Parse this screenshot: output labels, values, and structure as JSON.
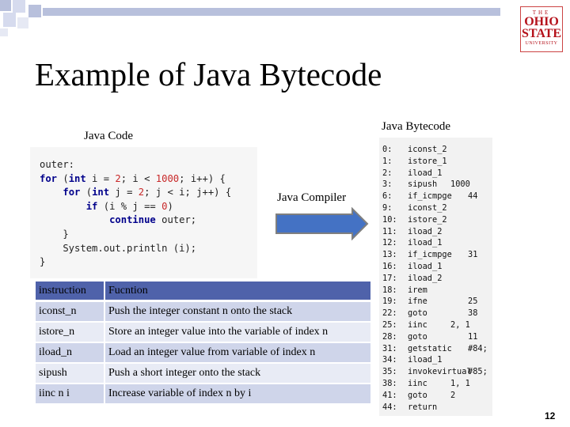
{
  "slide": {
    "title": "Example of Java Bytecode",
    "page_number": "12"
  },
  "logo": {
    "line1": "THE",
    "line2": "OHIO",
    "line3": "STATE",
    "line4": "UNIVERSITY"
  },
  "labels": {
    "java_code": "Java Code",
    "java_bytecode": "Java Bytecode",
    "java_compiler": "Java Compiler"
  },
  "java_code": {
    "lines": [
      "outer:",
      "for (int i = 2; i < 1000; i++) {",
      "    for (int j = 2; j < i; j++) {",
      "        if (i % j == 0)",
      "            continue outer;",
      "    }",
      "    System.out.println (i);",
      "}"
    ]
  },
  "bytecode": {
    "rows": [
      {
        "offset": "0:",
        "op": "iconst_2",
        "arg": ""
      },
      {
        "offset": "1:",
        "op": "istore_1",
        "arg": ""
      },
      {
        "offset": "2:",
        "op": "iload_1",
        "arg": ""
      },
      {
        "offset": "3:",
        "op": "sipush",
        "arg": "1000"
      },
      {
        "offset": "6:",
        "op": "if_icmpge",
        "arg": "44"
      },
      {
        "offset": "9:",
        "op": "iconst_2",
        "arg": ""
      },
      {
        "offset": "10:",
        "op": "istore_2",
        "arg": ""
      },
      {
        "offset": "11:",
        "op": "iload_2",
        "arg": ""
      },
      {
        "offset": "12:",
        "op": "iload_1",
        "arg": ""
      },
      {
        "offset": "13:",
        "op": "if_icmpge",
        "arg": "31"
      },
      {
        "offset": "16:",
        "op": "iload_1",
        "arg": ""
      },
      {
        "offset": "17:",
        "op": "iload_2",
        "arg": ""
      },
      {
        "offset": "18:",
        "op": "irem",
        "arg": ""
      },
      {
        "offset": "19:",
        "op": "ifne",
        "arg": "25"
      },
      {
        "offset": "22:",
        "op": "goto",
        "arg": "38"
      },
      {
        "offset": "25:",
        "op": "iinc",
        "arg": "2, 1"
      },
      {
        "offset": "28:",
        "op": "goto",
        "arg": "11"
      },
      {
        "offset": "31:",
        "op": "getstatic",
        "arg": "#84;"
      },
      {
        "offset": "34:",
        "op": "iload_1",
        "arg": ""
      },
      {
        "offset": "35:",
        "op": "invokevirtual",
        "arg": "#85;"
      },
      {
        "offset": "38:",
        "op": "iinc",
        "arg": "1, 1"
      },
      {
        "offset": "41:",
        "op": "goto",
        "arg": "2"
      },
      {
        "offset": "44:",
        "op": "return",
        "arg": ""
      }
    ]
  },
  "table": {
    "headers": [
      "instruction",
      "Fucntion"
    ],
    "rows": [
      [
        "iconst_n",
        "Push the integer constant n onto the stack"
      ],
      [
        "istore_n",
        "Store an integer value into the variable of index n"
      ],
      [
        "iload_n",
        "Load an integer value from variable of index n"
      ],
      [
        "sipush",
        "Push a short integer onto the stack"
      ],
      [
        "iinc n i",
        "Increase variable of index n by i"
      ]
    ]
  },
  "colors": {
    "table_header": "#4f62aa",
    "table_row_odd": "#cfd5ea",
    "table_row_even": "#e8ebf5",
    "arrow_fill": "#4472c4",
    "arrow_stroke": "#7f7f7f",
    "decor_squares": "#b8c0dc"
  }
}
